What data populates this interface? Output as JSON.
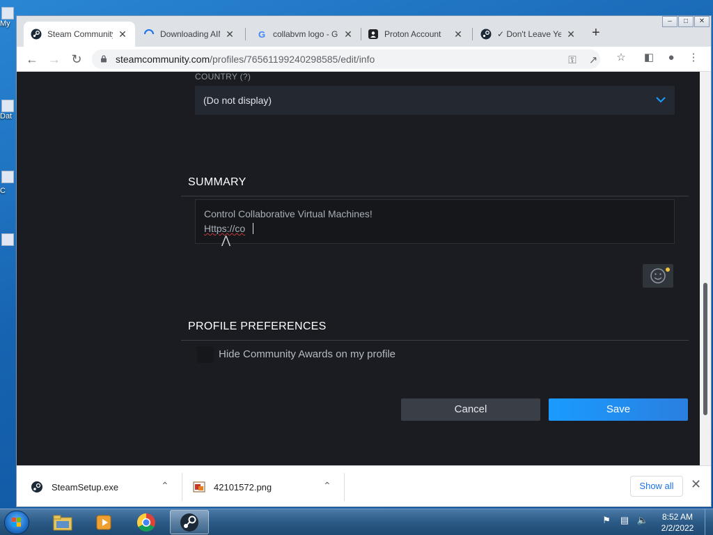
{
  "browser": {
    "tabs": [
      {
        "title": "Steam Community",
        "favicon": "steam-icon",
        "active": true
      },
      {
        "title": "Downloading AIM",
        "favicon": "loading-icon",
        "active": false
      },
      {
        "title": "collabvm logo - G",
        "favicon": "google-icon",
        "active": false
      },
      {
        "title": "Proton Account",
        "favicon": "proton-icon",
        "active": false
      },
      {
        "title": "✓ Don't Leave Yet",
        "favicon": "steam-icon",
        "active": false
      }
    ],
    "close_glyph": "✕",
    "new_tab_glyph": "+",
    "url_domain": "steamcommunity.com",
    "url_path": "/profiles/76561199240298585/edit/info"
  },
  "form": {
    "country_label": "COUNTRY (?)",
    "country_value": "(Do not display)",
    "summary_heading": "SUMMARY",
    "summary_line1": "Control Collaborative Virtual Machines!",
    "summary_line2": "Https://co",
    "preferences_heading": "PROFILE PREFERENCES",
    "hide_awards_label": "Hide Community Awards on my profile",
    "hide_awards_checked": false,
    "cancel_label": "Cancel",
    "save_label": "Save"
  },
  "downloads": {
    "items": [
      {
        "name": "SteamSetup.exe",
        "icon": "steam-file-icon"
      },
      {
        "name": "42101572.png",
        "icon": "image-file-icon"
      }
    ],
    "show_all_label": "Show all"
  },
  "desktop": {
    "icon_labels": [
      "My",
      "Dat",
      "",
      "C",
      ""
    ]
  },
  "taskbar": {
    "time": "8:52 AM",
    "date": "2/2/2022"
  },
  "colors": {
    "save_accent": "#1a9bff",
    "page_bg": "#1a1c22",
    "link_blue": "#1a73e8"
  }
}
